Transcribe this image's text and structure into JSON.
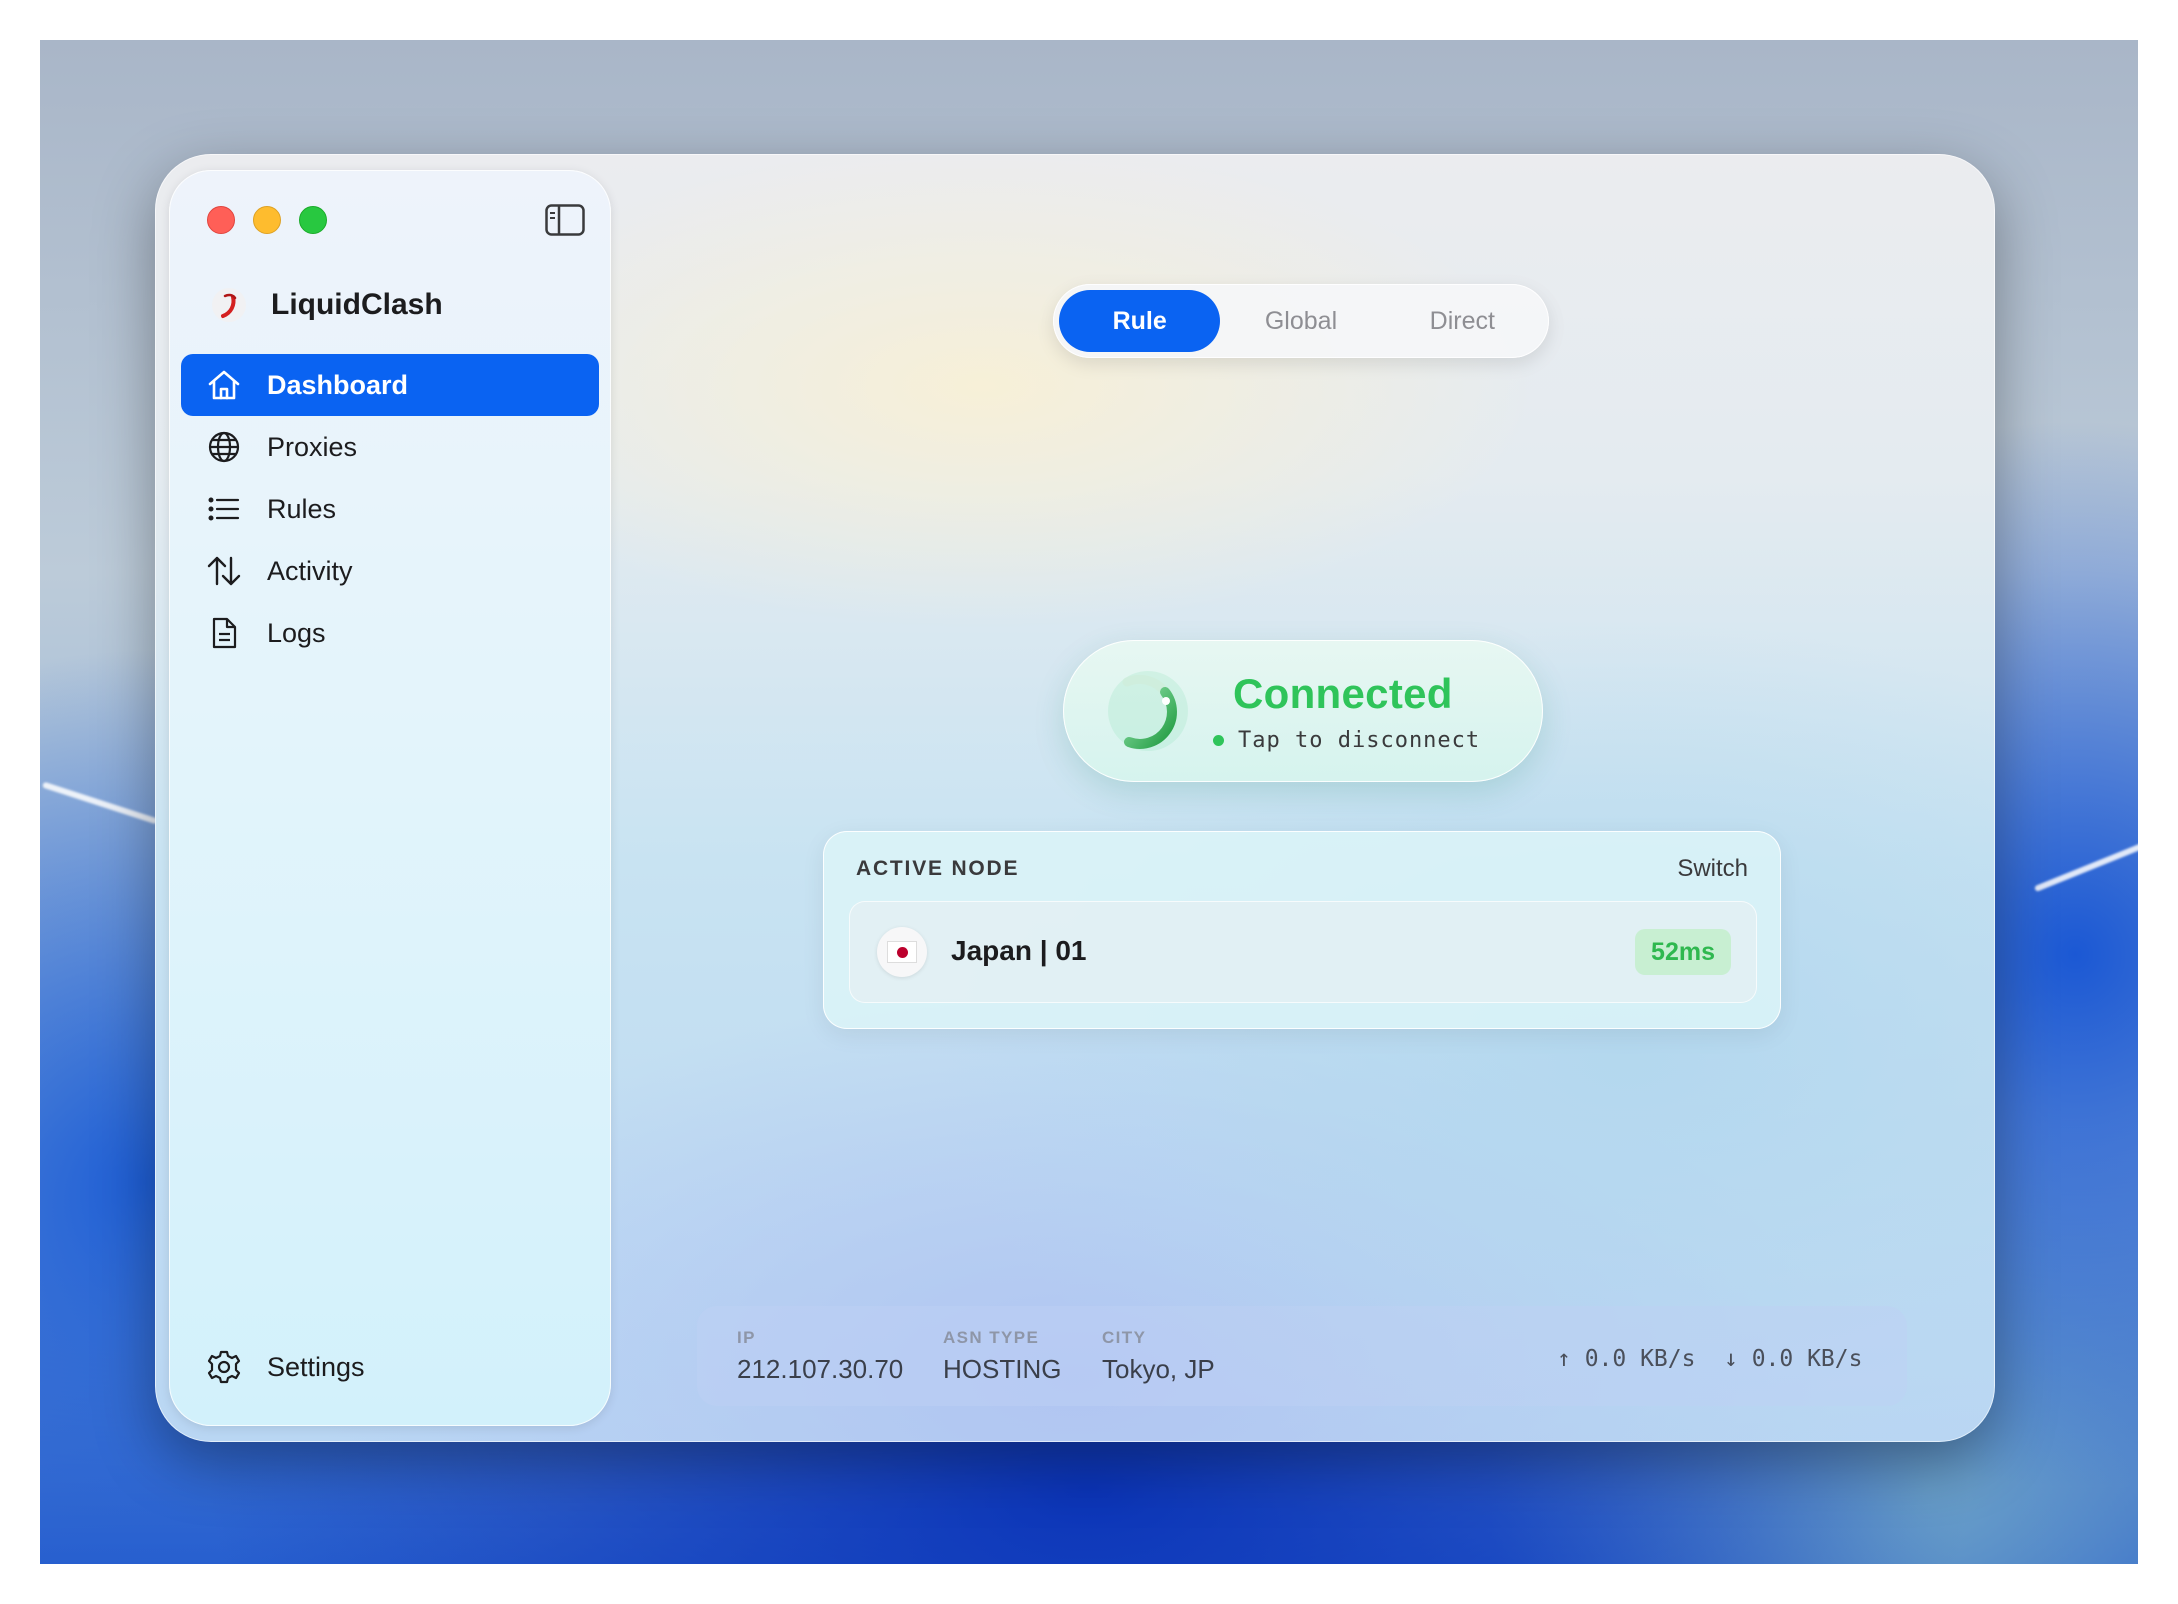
{
  "app": {
    "name": "LiquidClash"
  },
  "sidebar": {
    "items": [
      {
        "label": "Dashboard",
        "icon": "house-icon",
        "active": true
      },
      {
        "label": "Proxies",
        "icon": "globe-icon",
        "active": false
      },
      {
        "label": "Rules",
        "icon": "list-icon",
        "active": false
      },
      {
        "label": "Activity",
        "icon": "arrows-up-down-icon",
        "active": false
      },
      {
        "label": "Logs",
        "icon": "document-icon",
        "active": false
      }
    ],
    "settings_label": "Settings"
  },
  "mode": {
    "options": [
      "Rule",
      "Global",
      "Direct"
    ],
    "selected": "Rule"
  },
  "connection": {
    "status": "Connected",
    "action": "Tap to disconnect",
    "status_color": "#2FC45A"
  },
  "active_node": {
    "label": "ACTIVE NODE",
    "switch_label": "Switch",
    "name": "Japan | 01",
    "flag": "japan-flag",
    "latency": "52ms"
  },
  "network": {
    "ip_label": "IP",
    "ip": "212.107.30.70",
    "asn_label": "ASN TYPE",
    "asn": "HOSTING",
    "city_label": "CITY",
    "city": "Tokyo, JP",
    "upload": "↑ 0.0 KB/s",
    "download": "↓ 0.0 KB/s"
  },
  "colors": {
    "accent": "#0A63F2",
    "success": "#2FC45A"
  }
}
